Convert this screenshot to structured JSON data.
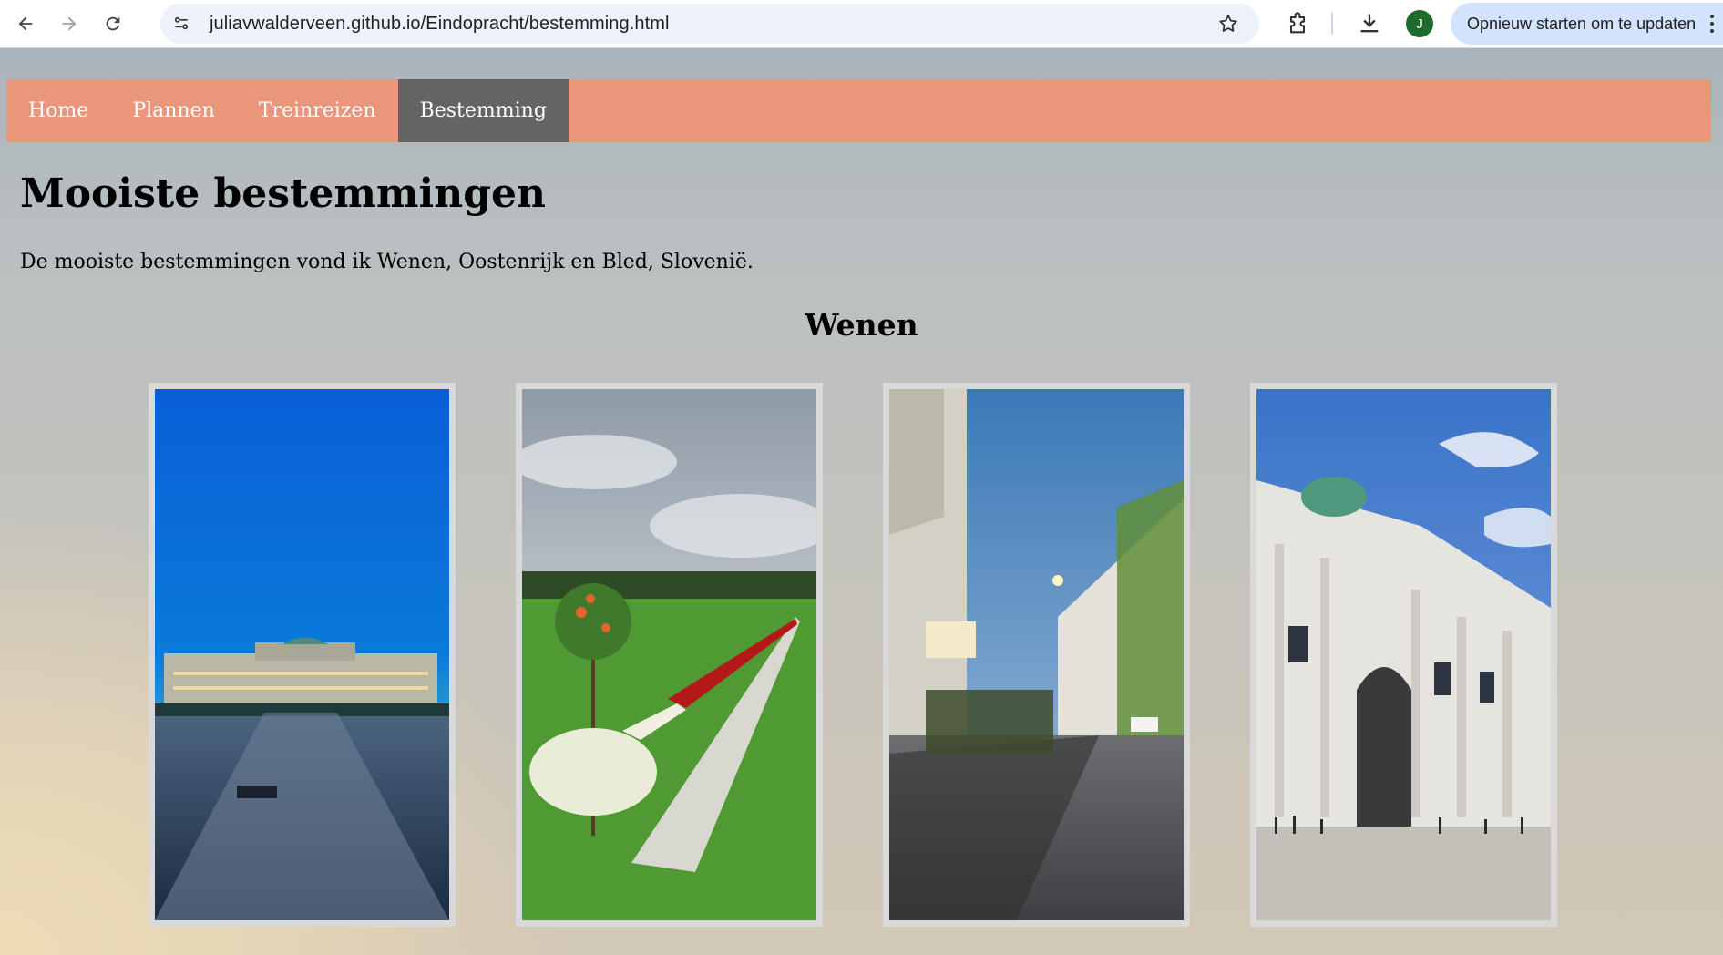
{
  "browser": {
    "url": "juliavwalderveen.github.io/Eindopracht/bestemming.html",
    "profile_initial": "J",
    "update_label": "Opnieuw starten om te updaten",
    "accent": "#d3e3fd"
  },
  "nav": {
    "items": [
      {
        "label": "Home"
      },
      {
        "label": "Plannen"
      },
      {
        "label": "Treinreizen"
      },
      {
        "label": "Bestemming"
      }
    ],
    "active": "Bestemming",
    "bar_color": "#e9967a",
    "active_color": "#646464"
  },
  "main": {
    "title": "Mooiste bestemmingen",
    "intro": "De mooiste bestemmingen vond ik Wenen, Oostenrijk en Bled, Slovenië.",
    "section_title": "Wenen",
    "photos": [
      {
        "subject": "palace-at-dusk"
      },
      {
        "subject": "garden-flowerbeds"
      },
      {
        "subject": "street-terrace-evening"
      },
      {
        "subject": "baroque-palace-facade"
      }
    ]
  }
}
